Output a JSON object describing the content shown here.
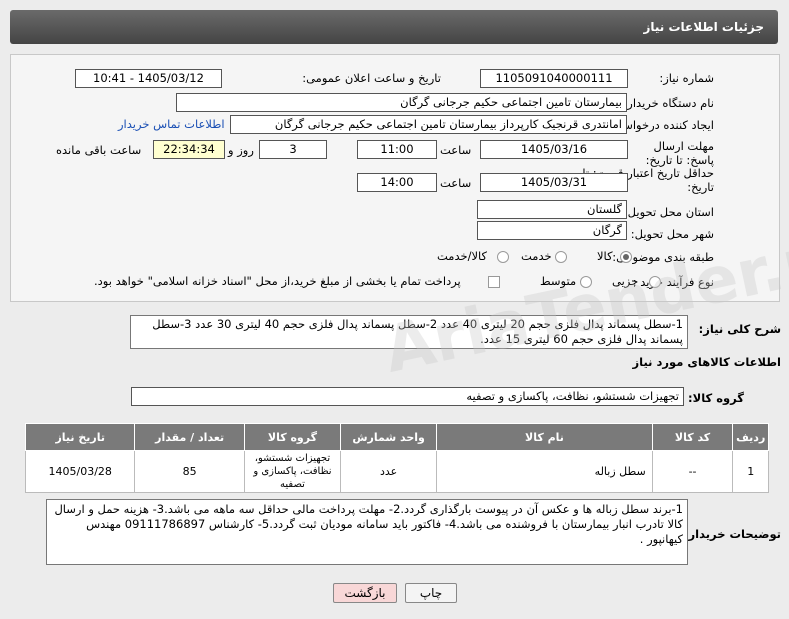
{
  "window": {
    "title": "جزئیات اطلاعات نیاز"
  },
  "form": {
    "need_number": {
      "label": "شماره نیاز:",
      "value": "1105091040000111"
    },
    "announce_date": {
      "label": "تاریخ و ساعت اعلان عمومی:",
      "value": "1405/03/12 - 10:41"
    },
    "buyer": {
      "label": "نام دستگاه خریدار:",
      "value": "بیمارستان تامین اجتماعی حکیم جرجانی گرگان"
    },
    "requester": {
      "label": "ایجاد کننده درخواست:",
      "value": "امانتدری قرنجیک کارپرداز بیمارستان تامین اجتماعی حکیم جرجانی گرگان",
      "contact_link": "اطلاعات تماس خریدار"
    },
    "reply_deadline": {
      "label": "مهلت ارسال پاسخ: تا تاریخ:",
      "date": "1405/03/16",
      "time_label": "ساعت",
      "time": "11:00",
      "days": "3",
      "days_label": "روز و",
      "remaining": "22:34:34",
      "remaining_label": "ساعت باقی مانده"
    },
    "price_validity": {
      "label": "حداقل تاریخ اعتبار قیمت: تا تاریخ:",
      "date": "1405/03/31",
      "time_label": "ساعت",
      "time": "14:00"
    },
    "province": {
      "label": "استان محل تحویل:",
      "value": "گلستان"
    },
    "city": {
      "label": "شهر محل تحویل:",
      "value": "گرگان"
    },
    "category": {
      "label": "طبقه بندی موضوعی:",
      "options": [
        "کالا",
        "خدمت",
        "کالا/خدمت"
      ],
      "selected": "کالا"
    },
    "purchase_type": {
      "label": "نوع فرآیند خرید :",
      "options": [
        "جزیی",
        "متوسط"
      ],
      "note": "پرداخت تمام یا بخشی از مبلغ خرید،از محل \"اسناد خزانه اسلامی\" خواهد بود."
    }
  },
  "description": {
    "label": "شرح کلی نیاز:",
    "value": "1-سطل پسماند پدال فلزی حجم 20 لیتری  40 عدد 2-سطل پسماند پدال فلزی حجم 40 لیتری   30 عدد 3-سطل پسماند پدال فلزی حجم 60 لیتری   15 عدد."
  },
  "goods_section": {
    "title": "اطلاعات کالاهای مورد نیاز",
    "group_label": "گروه کالا:",
    "group_value": "تجهیزات شستشو، نظافت، پاکسازی و تصفیه"
  },
  "table": {
    "headers": [
      "ردیف",
      "کد کالا",
      "نام کالا",
      "واحد شمارش",
      "گروه کالا",
      "تعداد / مقدار",
      "تاریخ نیاز"
    ],
    "rows": [
      [
        "1",
        "--",
        "سطل زباله",
        "عدد",
        "تجهیزات شستشو، نظافت، پاکسازی و تصفیه",
        "85",
        "1405/03/28"
      ]
    ]
  },
  "buyer_notes": {
    "label": "توضیحات خریدار:",
    "value": "1-برند سطل زباله ها و عکس آن در پیوست بارگذاری گردد.2- مهلت پرداخت مالی حداقل سه ماهه می باشد.3- هزینه حمل و ارسال کالا تادرب انبار بیمارستان با فروشنده می باشد.4- فاکتور باید سامانه مودیان ثبت گردد.5- کارشناس 09111786897 مهندس کیهانپور ."
  },
  "buttons": {
    "print": "چاپ",
    "back": "بازگشت"
  },
  "colors": {
    "title_bg": "#555555",
    "link": "#1a4fb4",
    "remaining_bg": "#ffffd0",
    "back_bg": "#f8d7d7"
  },
  "watermark": "AriaTender.net"
}
